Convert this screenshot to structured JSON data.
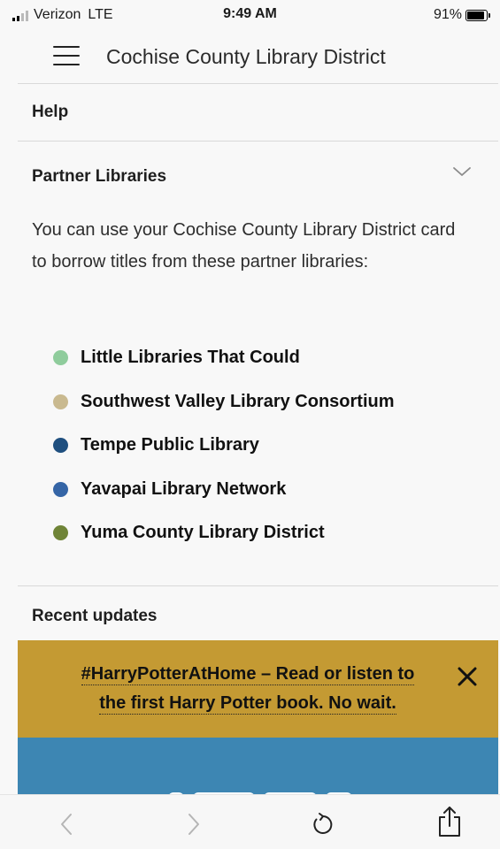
{
  "status_bar": {
    "carrier": "Verizon",
    "network": "LTE",
    "time": "9:49 AM",
    "battery_percent": "91%",
    "battery_level": 0.91
  },
  "header": {
    "title": "Cochise County Library District",
    "menu_icon": "hamburger-menu-icon"
  },
  "sections": {
    "help": "Help",
    "partner_libraries": "Partner Libraries",
    "recent_updates": "Recent updates"
  },
  "partner_intro": "You can use your Cochise County Library District card to borrow titles from these partner libraries:",
  "partners": [
    {
      "name": "Little Libraries That Could",
      "color": "#8fcc9c"
    },
    {
      "name": "Southwest Valley Library Consortium",
      "color": "#c9b98f"
    },
    {
      "name": "Tempe Public Library",
      "color": "#1f4f7f"
    },
    {
      "name": "Yavapai Library Network",
      "color": "#3565a6"
    },
    {
      "name": "Yuma County Library District",
      "color": "#6f8437"
    }
  ],
  "banner": {
    "line1": "#HarryPotterAtHome – Read or listen to",
    "line2": "the first Harry Potter book. No wait.",
    "background": "#c49a33",
    "close_icon": "close-icon"
  },
  "browser_toolbar": {
    "back_icon": "chevron-left-icon",
    "forward_icon": "chevron-right-icon",
    "reload_icon": "reload-icon",
    "share_icon": "share-icon"
  },
  "colors": {
    "accent_blue": "#3d86b3",
    "banner_gold": "#c49a33"
  }
}
